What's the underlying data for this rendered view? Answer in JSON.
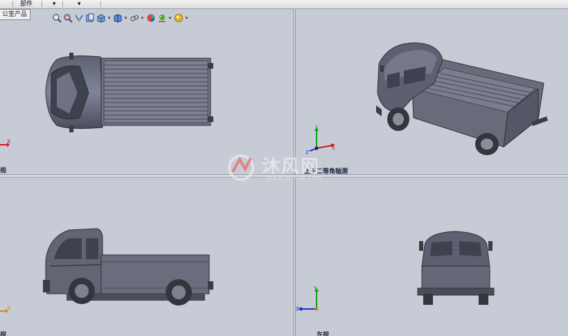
{
  "top_tabs": {
    "tab1": "部件",
    "tab2_arrow": "▾",
    "tab3_arrow": "▾"
  },
  "breadcrumb": "公室产品",
  "toolbar": {
    "icons": [
      "zoom-to-fit-icon",
      "zoom-area-icon",
      "previous-view-icon",
      "section-view-icon",
      "view-orientation-icon",
      "display-style-icon",
      "hide-show-icon",
      "edit-appearance-icon",
      "apply-scene-icon",
      "view-settings-icon"
    ],
    "dropdown_glyph": "▾"
  },
  "viewports": {
    "top_left": {
      "label": "视",
      "axis_x": "X"
    },
    "top_right": {
      "label": "上下二等角轴测",
      "axis_x": "X",
      "axis_y": "Y",
      "axis_z": "Z"
    },
    "bottom_left": {
      "label": "视",
      "axis_x": "X"
    },
    "bottom_right": {
      "label": "左视",
      "axis_y": "Y",
      "axis_z": "Z"
    }
  },
  "watermark": {
    "text": "沐风网",
    "url": "www.mfcad.com"
  },
  "colors": {
    "background": "#c6cbd5",
    "model": "#6a6e7c",
    "model_dark": "#3f4250",
    "axis_x": "#d01818",
    "axis_y": "#18a018",
    "axis_z": "#1830c8"
  }
}
